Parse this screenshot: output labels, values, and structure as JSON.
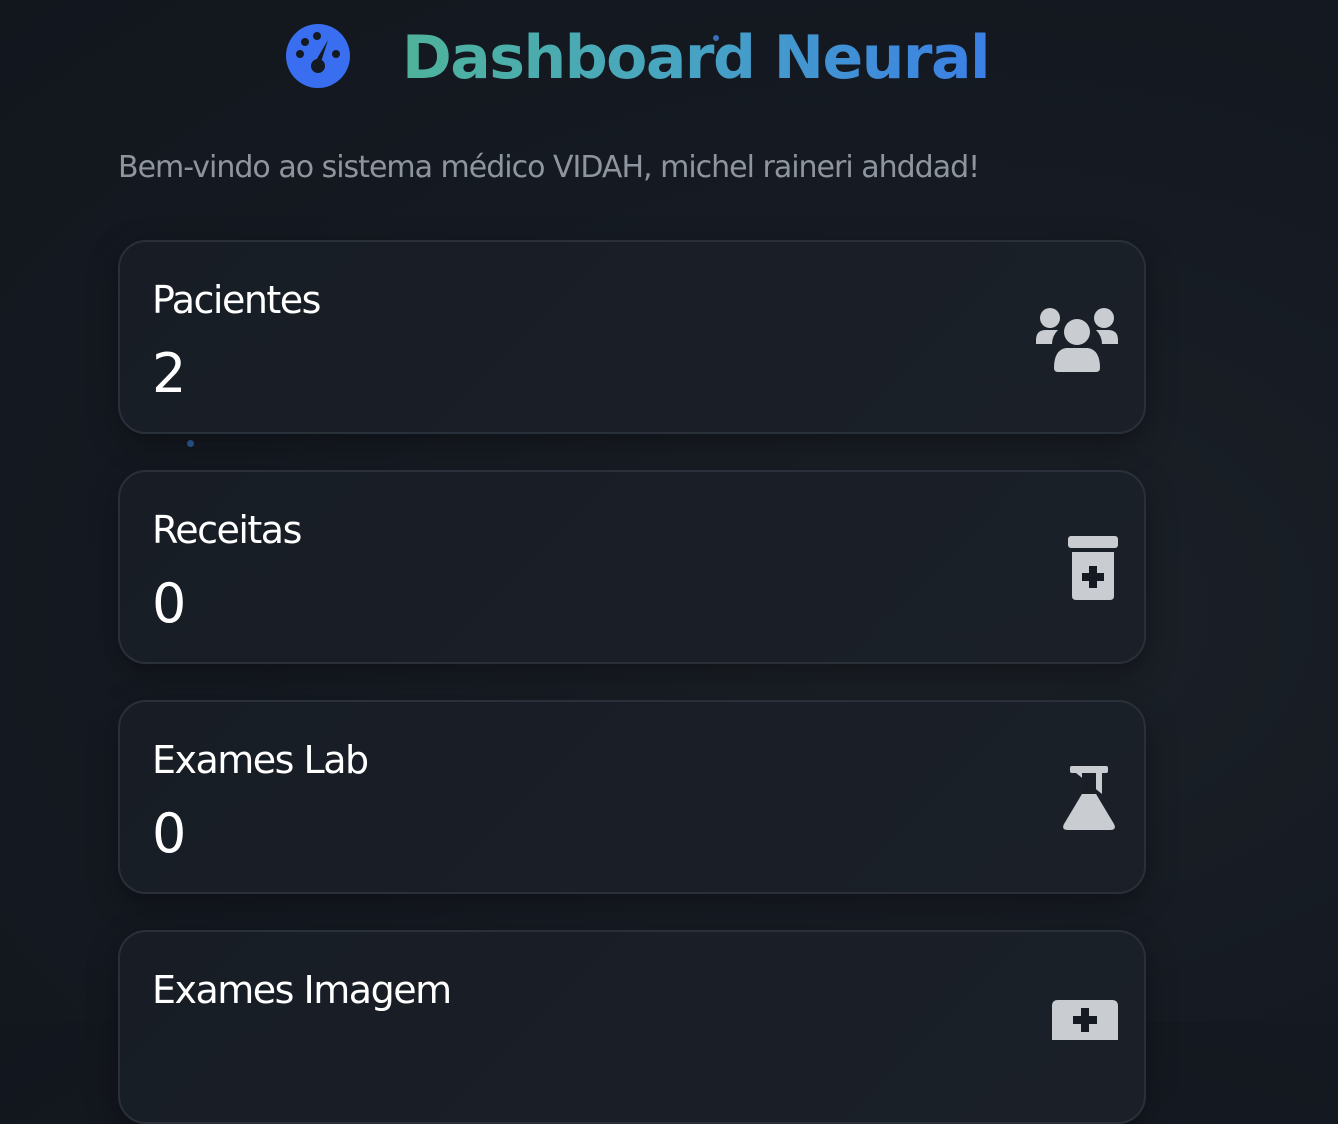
{
  "header": {
    "title": "Dashboard Neural",
    "icon": "tachometer-icon",
    "title_gradient": [
      "#4fb39b",
      "#3b7fe6"
    ],
    "icon_color": "#3a6ef0"
  },
  "welcome_text": "Bem-vindo ao sistema médico VIDAH, michel raineri ahddad!",
  "cards": [
    {
      "label": "Pacientes",
      "value": "2",
      "icon": "users-icon"
    },
    {
      "label": "Receitas",
      "value": "0",
      "icon": "prescription-bottle-icon"
    },
    {
      "label": "Exames Lab",
      "value": "0",
      "icon": "flask-icon"
    },
    {
      "label": "Exames Imagem",
      "value": "",
      "icon": "medical-kit-icon"
    }
  ],
  "colors": {
    "background": "#151a22",
    "card_background": "#1a1f27",
    "card_border": "#2a303a",
    "text_primary": "#ffffff",
    "text_muted": "#8e959e",
    "icon_gray": "#c9ccd1"
  }
}
